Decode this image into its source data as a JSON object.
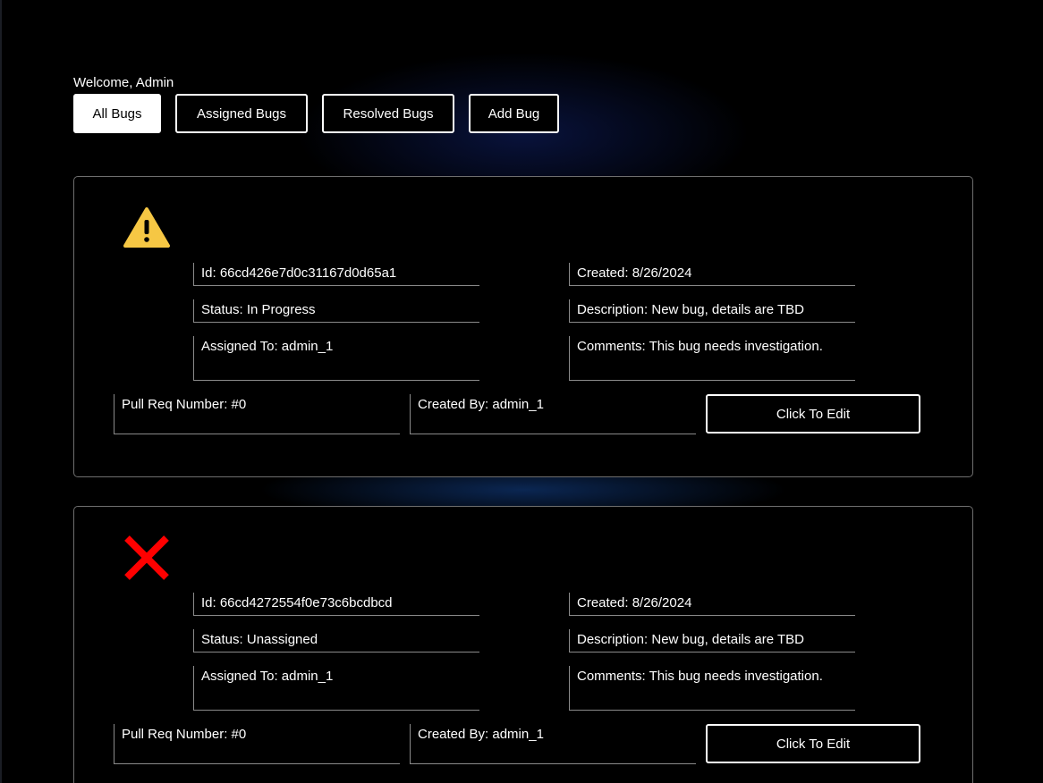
{
  "header": {
    "welcome": "Welcome, Admin"
  },
  "nav": {
    "all_bugs": "All Bugs",
    "assigned_bugs": "Assigned Bugs",
    "resolved_bugs": "Resolved Bugs",
    "add_bug": "Add Bug",
    "active": "All Bugs"
  },
  "bugs": [
    {
      "icon": "warning-icon",
      "icon_color": "#f6c744",
      "id": "Id: 66cd426e7d0c31167d0d65a1",
      "created": "Created: 8/26/2024",
      "status": "Status: In Progress",
      "description": "Description: New bug, details are TBD",
      "assigned_to": "Assigned To: admin_1",
      "comments": "Comments: This bug needs investigation.",
      "pull_req": "Pull Req Number: #0",
      "created_by": "Created By: admin_1",
      "edit_label": "Click To Edit"
    },
    {
      "icon": "close-x-icon",
      "icon_color": "#ff0000",
      "id": "Id: 66cd4272554f0e73c6bcdbcd",
      "created": "Created: 8/26/2024",
      "status": "Status: Unassigned",
      "description": "Description: New bug, details are TBD",
      "assigned_to": "Assigned To: admin_1",
      "comments": "Comments: This bug needs investigation.",
      "pull_req": "Pull Req Number: #0",
      "created_by": "Created By: admin_1",
      "edit_label": "Click To Edit"
    }
  ]
}
